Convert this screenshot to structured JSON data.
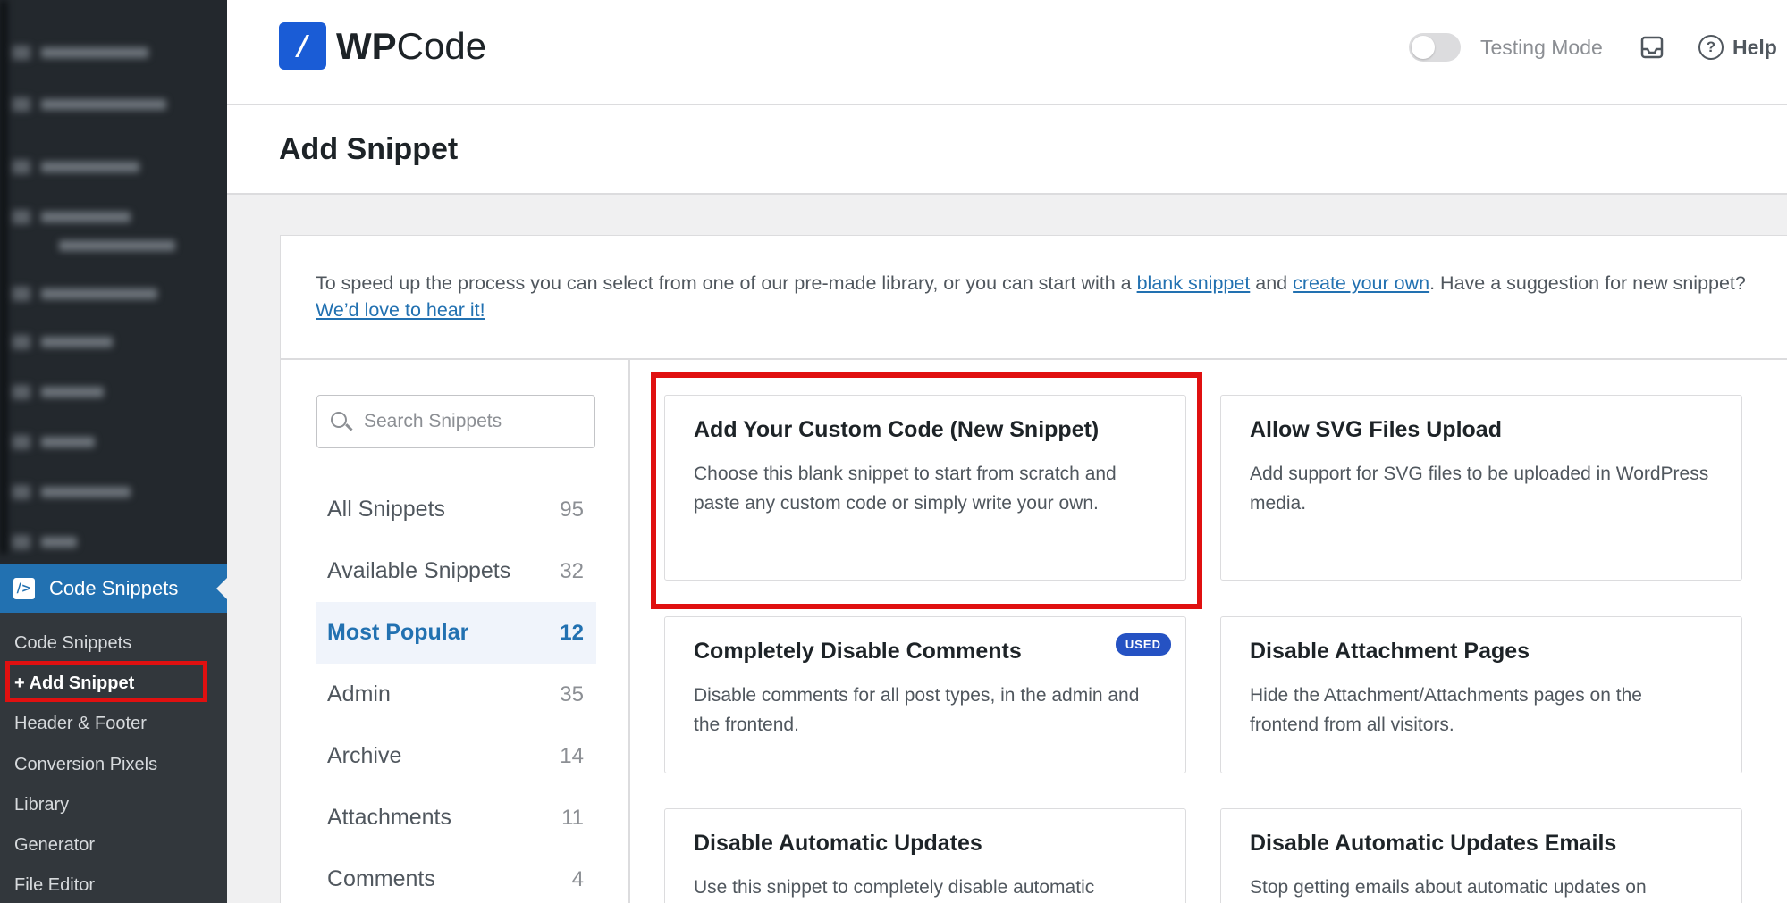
{
  "header": {
    "logo_bold": "WP",
    "logo_light": "Code",
    "testing_mode_label": "Testing Mode",
    "help_label": "Help"
  },
  "page_title": "Add Snippet",
  "intro": {
    "text_1": "To speed up the process you can select from one of our pre-made library, or you can start with a ",
    "link_blank": "blank snippet",
    "text_2": " and ",
    "link_create": "create your own",
    "text_3": ". Have a suggestion for new snippet? ",
    "link_suggest": "We’d love to hear it!"
  },
  "sidebar": {
    "active_menu": "Code Snippets",
    "submenu": [
      {
        "label": "Code Snippets"
      },
      {
        "label": "+ Add Snippet"
      },
      {
        "label": "Header & Footer"
      },
      {
        "label": "Conversion Pixels"
      },
      {
        "label": "Library"
      },
      {
        "label": "Generator"
      },
      {
        "label": "File Editor"
      }
    ]
  },
  "search": {
    "placeholder": "Search Snippets"
  },
  "categories": [
    {
      "label": "All Snippets",
      "count": "95"
    },
    {
      "label": "Available Snippets",
      "count": "32"
    },
    {
      "label": "Most Popular",
      "count": "12"
    },
    {
      "label": "Admin",
      "count": "35"
    },
    {
      "label": "Archive",
      "count": "14"
    },
    {
      "label": "Attachments",
      "count": "11"
    },
    {
      "label": "Comments",
      "count": "4"
    }
  ],
  "cards": [
    {
      "title": "Add Your Custom Code (New Snippet)",
      "desc": "Choose this blank snippet to start from scratch and paste any custom code or simply write your own."
    },
    {
      "title": "Allow SVG Files Upload",
      "desc": "Add support for SVG files to be uploaded in WordPress media."
    },
    {
      "title": "Completely Disable Comments",
      "desc": "Disable comments for all post types, in the admin and the frontend.",
      "badge": "USED"
    },
    {
      "title": "Disable Attachment Pages",
      "desc": "Hide the Attachment/Attachments pages on the frontend from all visitors."
    },
    {
      "title": "Disable Automatic Updates",
      "desc": "Use this snippet to completely disable automatic"
    },
    {
      "title": "Disable Automatic Updates Emails",
      "desc": "Stop getting emails about automatic updates on"
    }
  ],
  "colors": {
    "accent": "#2271b1",
    "logo": "#1a5cd6",
    "highlight": "#e01010",
    "sidebar": "#23282d"
  }
}
